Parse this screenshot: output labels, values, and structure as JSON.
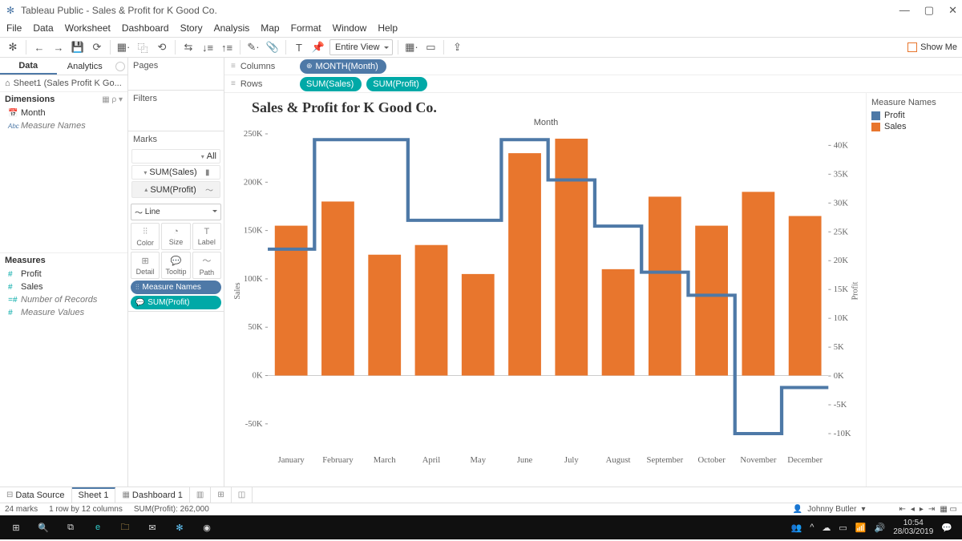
{
  "app": {
    "title": "Tableau Public - Sales & Profit for K Good Co."
  },
  "window_buttons": {
    "min": "—",
    "max": "▢",
    "close": "✕"
  },
  "menu": [
    "File",
    "Data",
    "Worksheet",
    "Dashboard",
    "Story",
    "Analysis",
    "Map",
    "Format",
    "Window",
    "Help"
  ],
  "toolbar": {
    "view_mode": "Entire View",
    "show_me": "Show Me"
  },
  "side_tabs": {
    "data": "Data",
    "analytics": "Analytics"
  },
  "datasource": {
    "icon": "⌂",
    "name": "Sheet1 (Sales Profit K Go..."
  },
  "dimensions": {
    "title": "Dimensions",
    "items": [
      {
        "icon": "📅",
        "label": "Month",
        "color": "blue"
      },
      {
        "icon": "Abc",
        "label": "Measure Names",
        "italic": true,
        "color": "blue"
      }
    ]
  },
  "measures": {
    "title": "Measures",
    "items": [
      {
        "icon": "#",
        "label": "Profit"
      },
      {
        "icon": "#",
        "label": "Sales"
      },
      {
        "icon": "=#",
        "label": "Number of Records",
        "italic": true
      },
      {
        "icon": "#",
        "label": "Measure Values",
        "italic": true
      }
    ]
  },
  "shelf": {
    "pages": "Pages",
    "filters": "Filters",
    "marks": "Marks",
    "all": "All",
    "sum_sales": "SUM(Sales)",
    "sum_profit": "SUM(Profit)",
    "line": "Line",
    "cells": [
      "Color",
      "Size",
      "Label",
      "Detail",
      "Tooltip",
      "Path"
    ],
    "measure_names": "Measure Names",
    "sum_profit_pill": "SUM(Profit)"
  },
  "shelves": {
    "columns": {
      "label": "Columns",
      "pills": [
        {
          "text": "MONTH(Month)",
          "style": "blue",
          "icon": "⊕"
        }
      ]
    },
    "rows": {
      "label": "Rows",
      "pills": [
        {
          "text": "SUM(Sales)",
          "style": "teal"
        },
        {
          "text": "SUM(Profit)",
          "style": "teal"
        }
      ]
    }
  },
  "chart": {
    "title": "Sales & Profit for K Good Co.",
    "xaxis_title": "Month"
  },
  "legend": {
    "title": "Measure Names",
    "items": [
      {
        "label": "Profit",
        "color": "#4e79a7"
      },
      {
        "label": "Sales",
        "color": "#e8762d"
      }
    ]
  },
  "chart_data": {
    "type": "bar",
    "categories": [
      "January",
      "February",
      "March",
      "April",
      "May",
      "June",
      "July",
      "August",
      "September",
      "October",
      "November",
      "December"
    ],
    "series": [
      {
        "name": "Sales",
        "type": "bar",
        "color": "#e8762d",
        "values": [
          155000,
          180000,
          125000,
          135000,
          105000,
          230000,
          245000,
          110000,
          185000,
          155000,
          190000,
          165000
        ]
      },
      {
        "name": "Profit",
        "type": "step-line",
        "color": "#4e79a7",
        "values": [
          22000,
          41000,
          41000,
          27000,
          27000,
          41000,
          34000,
          26000,
          18000,
          14000,
          -10000,
          -2000
        ]
      }
    ],
    "y_left": {
      "label": "Sales",
      "min": -75000,
      "max": 250000,
      "ticks": [
        -50000,
        0,
        50000,
        100000,
        150000,
        200000,
        250000
      ],
      "tick_labels": [
        "-50K",
        "0K",
        "50K",
        "100K",
        "150K",
        "200K",
        "250K"
      ]
    },
    "y_right": {
      "label": "Profit",
      "min": -12500,
      "max": 42000,
      "ticks": [
        -10000,
        -5000,
        0,
        5000,
        10000,
        15000,
        20000,
        25000,
        30000,
        35000,
        40000
      ],
      "tick_labels": [
        "-10K",
        "-5K",
        "0K",
        "5K",
        "10K",
        "15K",
        "20K",
        "25K",
        "30K",
        "35K",
        "40K"
      ]
    }
  },
  "sheet_tabs": {
    "data_source": "Data Source",
    "sheet1": "Sheet 1",
    "dashboard1": "Dashboard 1"
  },
  "status": {
    "marks": "24 marks",
    "dims": "1 row by 12 columns",
    "agg": "SUM(Profit): 262,000",
    "user": "Johnny Butler"
  },
  "taskbar": {
    "time": "10:54",
    "date": "28/03/2019"
  }
}
